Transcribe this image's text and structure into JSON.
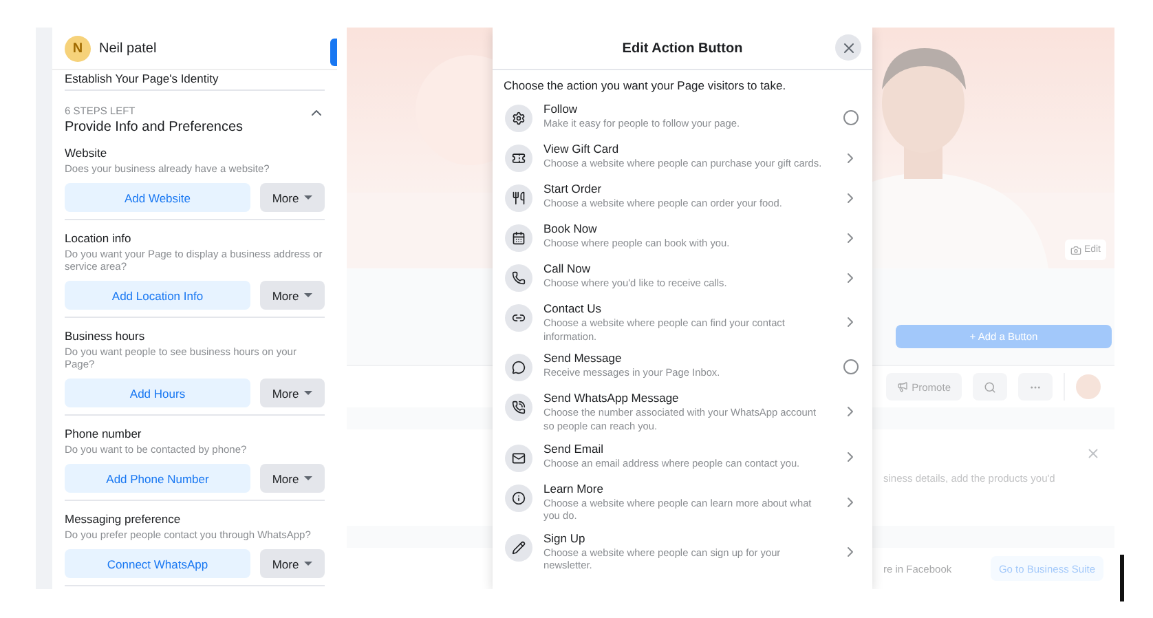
{
  "left_panel": {
    "profile": {
      "initial": "N",
      "name": "Neil patel"
    },
    "previous_section": "Establish Your Page's Identity",
    "section": {
      "steps_left": "6 STEPS LEFT",
      "title": "Provide Info and Preferences",
      "expanded": true
    },
    "tasks": [
      {
        "title": "Website",
        "description": "Does your business already have a website?",
        "action": "Add Website",
        "more": "More"
      },
      {
        "title": "Location info",
        "description": "Do you want your Page to display a business address or service area?",
        "action": "Add Location Info",
        "more": "More"
      },
      {
        "title": "Business hours",
        "description": "Do you want people to see business hours on your Page?",
        "action": "Add Hours",
        "more": "More"
      },
      {
        "title": "Phone number",
        "description": "Do you want to be contacted by phone?",
        "action": "Add Phone Number",
        "more": "More"
      },
      {
        "title": "Messaging preference",
        "description": "Do you prefer people contact you through WhatsApp?",
        "action": "Connect WhatsApp",
        "more": "More"
      }
    ]
  },
  "background_page": {
    "edit": "Edit",
    "add_button": "+ Add a Button",
    "promote": "Promote",
    "card_text": "siness details, add the products you'd",
    "footer_text": "re in Facebook",
    "business_suite": "Go to Business Suite"
  },
  "modal": {
    "title": "Edit Action Button",
    "prompt": "Choose the action you want your Page visitors to take.",
    "actions": [
      {
        "title": "Follow",
        "description": "Make it easy for people to follow your page.",
        "kind": "radio",
        "selected": false
      },
      {
        "title": "View Gift Card",
        "description": "Choose a website where people can purchase your gift cards.",
        "kind": "link"
      },
      {
        "title": "Start Order",
        "description": "Choose a website where people can order your food.",
        "kind": "link"
      },
      {
        "title": "Book Now",
        "description": "Choose where people can book with you.",
        "kind": "link"
      },
      {
        "title": "Call Now",
        "description": "Choose where you'd like to receive calls.",
        "kind": "link"
      },
      {
        "title": "Contact Us",
        "description": "Choose a website where people can find your contact information.",
        "kind": "link"
      },
      {
        "title": "Send Message",
        "description": "Receive messages in your Page Inbox.",
        "kind": "radio",
        "selected": false
      },
      {
        "title": "Send WhatsApp Message",
        "description": "Choose the number associated with your WhatsApp account so people can reach you.",
        "kind": "link"
      },
      {
        "title": "Send Email",
        "description": "Choose an email address where people can contact you.",
        "kind": "link"
      },
      {
        "title": "Learn More",
        "description": "Choose a website where people can learn more about what you do.",
        "kind": "link"
      },
      {
        "title": "Sign Up",
        "description": "Choose a website where people can sign up for your newsletter.",
        "kind": "link"
      }
    ]
  }
}
